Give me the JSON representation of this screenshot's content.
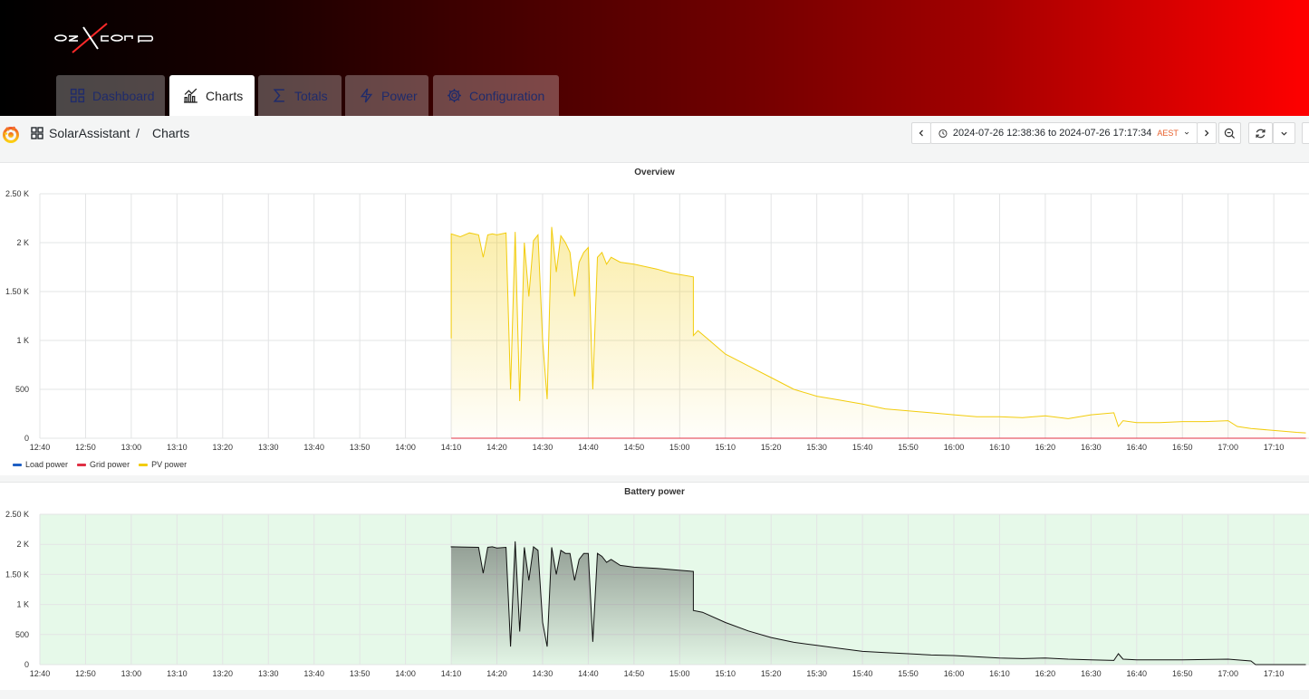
{
  "header": {
    "logo_text": "ozxcorp",
    "tabs": [
      {
        "label": "Dashboard",
        "icon": "grid-icon",
        "active": false
      },
      {
        "label": "Charts",
        "icon": "chart-icon",
        "active": true
      },
      {
        "label": "Totals",
        "icon": "sigma-icon",
        "active": false
      },
      {
        "label": "Power",
        "icon": "bolt-icon",
        "active": false
      },
      {
        "label": "Configuration",
        "icon": "gear-icon",
        "active": false
      }
    ]
  },
  "toolbar": {
    "dashboard": "SolarAssistant",
    "separator": "/",
    "page": "Charts",
    "time_range": "2024-07-26 12:38:36 to 2024-07-26 17:17:34",
    "timezone": "AEST"
  },
  "chart_data": [
    {
      "type": "area",
      "title": "Overview",
      "x_ticks": [
        "12:40",
        "12:50",
        "13:00",
        "13:10",
        "13:20",
        "13:30",
        "13:40",
        "13:50",
        "14:00",
        "14:10",
        "14:20",
        "14:30",
        "14:40",
        "14:50",
        "15:00",
        "15:10",
        "15:20",
        "15:30",
        "15:40",
        "15:50",
        "16:00",
        "16:10",
        "16:20",
        "16:30",
        "16:40",
        "16:50",
        "17:00",
        "17:10"
      ],
      "y_ticks": [
        "0",
        "500",
        "1 K",
        "1.50 K",
        "2 K",
        "2.50 K"
      ],
      "ylim": [
        0,
        2500
      ],
      "legend": "bottom-left",
      "series": [
        {
          "name": "Load power",
          "color": "#1f60c4",
          "x": [],
          "values": []
        },
        {
          "name": "Grid power",
          "color": "#e02f44",
          "x": [
            "14:10",
            "17:17"
          ],
          "values": [
            0,
            0
          ]
        },
        {
          "name": "PV power",
          "color": "#f2cc0c",
          "x": [
            "14:10",
            "14:10",
            "14:12",
            "14:14",
            "14:16",
            "14:17",
            "14:18",
            "14:19",
            "14:20",
            "14:22",
            "14:23",
            "14:24",
            "14:25",
            "14:26",
            "14:27",
            "14:28",
            "14:29",
            "14:30",
            "14:31",
            "14:32",
            "14:33",
            "14:34",
            "14:35",
            "14:36",
            "14:37",
            "14:38",
            "14:39",
            "14:40",
            "14:41",
            "14:42",
            "14:43",
            "14:44",
            "14:45",
            "14:47",
            "14:50",
            "14:55",
            "14:58",
            "15:03",
            "15:03",
            "15:04",
            "15:06",
            "15:10",
            "15:15",
            "15:20",
            "15:25",
            "15:30",
            "15:35",
            "15:40",
            "15:45",
            "15:50",
            "15:55",
            "16:00",
            "16:05",
            "16:10",
            "16:15",
            "16:20",
            "16:25",
            "16:30",
            "16:35",
            "16:36",
            "16:37",
            "16:40",
            "16:45",
            "16:50",
            "16:55",
            "17:00",
            "17:02",
            "17:05",
            "17:10",
            "17:15",
            "17:17"
          ],
          "values": [
            1020,
            2090,
            2060,
            2100,
            2080,
            1850,
            2080,
            2090,
            2080,
            2100,
            500,
            2110,
            380,
            2000,
            1450,
            2020,
            2080,
            1000,
            400,
            2160,
            1700,
            2070,
            2000,
            1900,
            1450,
            1800,
            1900,
            1950,
            500,
            1850,
            1900,
            1780,
            1850,
            1800,
            1780,
            1730,
            1690,
            1650,
            1050,
            1100,
            1020,
            860,
            740,
            620,
            500,
            430,
            390,
            350,
            300,
            280,
            260,
            240,
            220,
            220,
            210,
            230,
            200,
            240,
            260,
            120,
            180,
            160,
            160,
            170,
            170,
            180,
            120,
            100,
            80,
            60,
            55
          ]
        }
      ]
    },
    {
      "type": "area",
      "title": "Battery power",
      "x_ticks": [
        "12:40",
        "12:50",
        "13:00",
        "13:10",
        "13:20",
        "13:30",
        "13:40",
        "13:50",
        "14:00",
        "14:10",
        "14:20",
        "14:30",
        "14:40",
        "14:50",
        "15:00",
        "15:10",
        "15:20",
        "15:30",
        "15:40",
        "15:50",
        "16:00",
        "16:10",
        "16:20",
        "16:30",
        "16:40",
        "16:50",
        "17:00",
        "17:10"
      ],
      "y_ticks": [
        "0",
        "500",
        "1 K",
        "1.50 K",
        "1.50 K",
        "2 K",
        "2.50 K"
      ],
      "ylim": [
        0,
        2500
      ],
      "background": "#e6f9e9",
      "series": [
        {
          "name": "",
          "color": "#111111",
          "x": [
            "14:10",
            "14:10",
            "14:16",
            "14:17",
            "14:18",
            "14:19",
            "14:20",
            "14:22",
            "14:23",
            "14:24",
            "14:25",
            "14:26",
            "14:27",
            "14:28",
            "14:29",
            "14:30",
            "14:31",
            "14:32",
            "14:33",
            "14:34",
            "14:35",
            "14:36",
            "14:37",
            "14:38",
            "14:39",
            "14:40",
            "14:41",
            "14:42",
            "14:43",
            "14:44",
            "14:45",
            "14:47",
            "14:50",
            "14:55",
            "15:03",
            "15:03",
            "15:05",
            "15:10",
            "15:15",
            "15:20",
            "15:25",
            "15:30",
            "15:35",
            "15:40",
            "15:45",
            "15:50",
            "15:55",
            "16:00",
            "16:05",
            "16:10",
            "16:15",
            "16:20",
            "16:25",
            "16:30",
            "16:35",
            "16:36",
            "16:37",
            "16:40",
            "16:45",
            "16:50",
            "17:00",
            "17:05",
            "17:06",
            "17:10",
            "17:17"
          ],
          "values": [
            1950,
            1960,
            1950,
            1520,
            1950,
            1960,
            1940,
            1950,
            300,
            2050,
            550,
            1950,
            1400,
            1960,
            1900,
            700,
            300,
            1950,
            1500,
            1900,
            1850,
            1850,
            1400,
            1750,
            1850,
            1850,
            380,
            1850,
            1800,
            1700,
            1750,
            1650,
            1620,
            1600,
            1550,
            900,
            870,
            700,
            560,
            450,
            370,
            320,
            270,
            220,
            200,
            180,
            160,
            150,
            130,
            110,
            100,
            110,
            90,
            80,
            70,
            180,
            90,
            80,
            80,
            80,
            90,
            60,
            0,
            0,
            0
          ]
        }
      ]
    }
  ]
}
